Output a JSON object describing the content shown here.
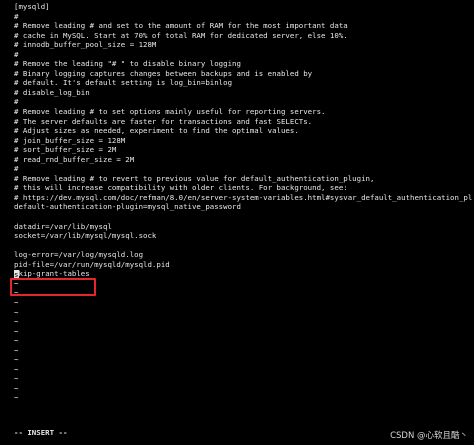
{
  "editor": {
    "lines": [
      "[mysqld]",
      "#",
      "# Remove leading # and set to the amount of RAM for the most important data",
      "# cache in MySQL. Start at 70% of total RAM for dedicated server, else 10%.",
      "# innodb_buffer_pool_size = 128M",
      "#",
      "# Remove the leading \"# \" to disable binary logging",
      "# Binary logging captures changes between backups and is enabled by",
      "# default. It's default setting is log_bin=binlog",
      "# disable_log_bin",
      "#",
      "# Remove leading # to set options mainly useful for reporting servers.",
      "# The server defaults are faster for transactions and fast SELECTs.",
      "# Adjust sizes as needed, experiment to find the optimal values.",
      "# join_buffer_size = 128M",
      "# sort_buffer_size = 2M",
      "# read_rnd_buffer_size = 2M",
      "#",
      "# Remove leading # to revert to previous value for default_authentication_plugin,",
      "# this will increase compatibility with older clients. For background, see:",
      "# https://dev.mysql.com/doc/refman/8.0/en/server-system-variables.html#sysvar_default_authentication_plugin",
      "default-authentication-plugin=mysql_native_password",
      "",
      "datadir=/var/lib/mysql",
      "socket=/var/lib/mysql/mysql.sock",
      "",
      "log-error=/var/log/mysqld.log",
      "pid-file=/var/run/mysqld/mysqld.pid"
    ],
    "inserted_line_cursor_char": "s",
    "inserted_line_rest": "kip-grant-tables",
    "empty_line_marker": "~",
    "empty_line_count": 13
  },
  "status": {
    "mode": "-- INSERT --"
  },
  "watermark": {
    "text": "CSDN @心软且酷丶"
  },
  "colors": {
    "background": "#000000",
    "text": "#e8e8e8",
    "highlight_border": "#e5262c"
  }
}
